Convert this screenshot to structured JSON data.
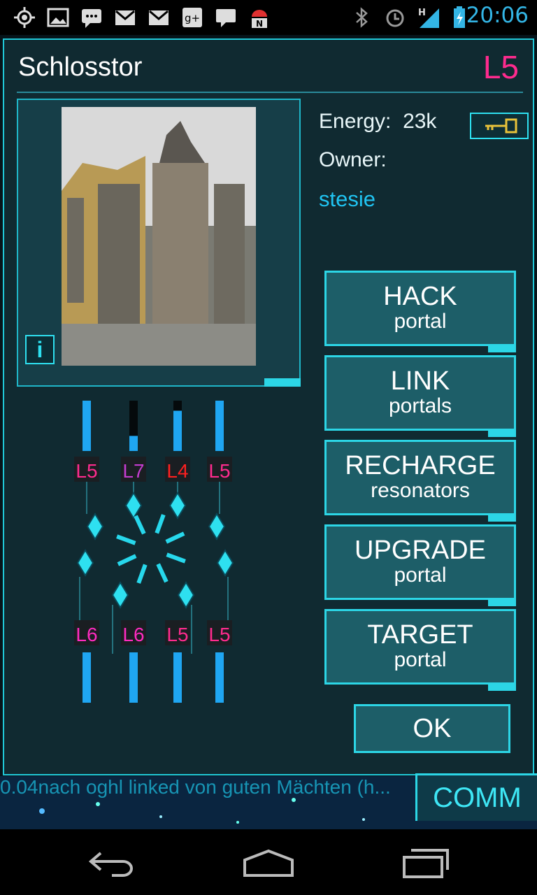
{
  "status_bar": {
    "time": "20:06",
    "icons": [
      "gps-icon",
      "picture-icon",
      "sms-icon",
      "gmail-icon",
      "gmail-icon",
      "gplus-icon",
      "chat-icon",
      "android-icon",
      "bluetooth-icon",
      "alarm-icon",
      "signal-icon",
      "battery-icon"
    ],
    "network_type": "H"
  },
  "portal": {
    "name": "Schlosstor",
    "level": "L5",
    "energy_label": "Energy:",
    "energy_value": "23k",
    "owner_label": "Owner:",
    "owner_name": "stesie",
    "info_label": "i"
  },
  "resonators": {
    "top": [
      {
        "level": "L5",
        "color": "#ff2b8e",
        "fill": 1.0
      },
      {
        "level": "L7",
        "color": "#c43ccf",
        "fill": 0.3
      },
      {
        "level": "L4",
        "color": "#ff2020",
        "fill": 0.8
      },
      {
        "level": "L5",
        "color": "#ff2b8e",
        "fill": 1.0
      }
    ],
    "bottom": [
      {
        "level": "L6",
        "color": "#ff2bc0",
        "fill": 1.0
      },
      {
        "level": "L6",
        "color": "#ff2bc0",
        "fill": 1.0
      },
      {
        "level": "L5",
        "color": "#ff2b8e",
        "fill": 1.0
      },
      {
        "level": "L5",
        "color": "#ff2b8e",
        "fill": 1.0
      }
    ]
  },
  "actions": [
    {
      "main": "HACK",
      "sub": "portal"
    },
    {
      "main": "LINK",
      "sub": "portals"
    },
    {
      "main": "RECHARGE",
      "sub": "resonators"
    },
    {
      "main": "UPGRADE",
      "sub": "portal"
    },
    {
      "main": "TARGET",
      "sub": "portal"
    }
  ],
  "ok_label": "OK",
  "comm": {
    "label": "COMM",
    "ticker": "0.04nach oghl linked von guten Mächten (h..."
  },
  "colors": {
    "accent": "#2cd6e6",
    "owner": "#20c4f2",
    "level": "#ff2b8e"
  }
}
